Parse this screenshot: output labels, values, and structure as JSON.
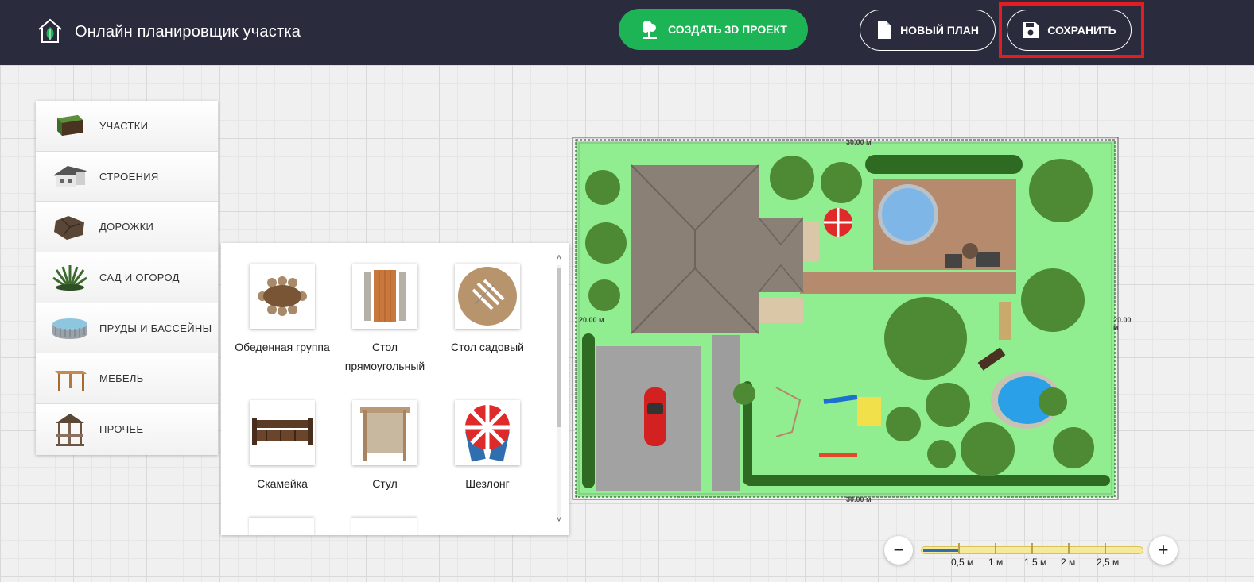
{
  "header": {
    "app_title": "Онлайн планировщик участка",
    "create_3d_label": "СОЗДАТЬ 3D ПРОЕКТ",
    "new_plan_label": "НОВЫЙ ПЛАН",
    "save_label": "СОХРАНИТЬ"
  },
  "categories": [
    {
      "label": "УЧАСТКИ",
      "icon": "grass-tile-icon"
    },
    {
      "label": "СТРОЕНИЯ",
      "icon": "house-icon"
    },
    {
      "label": "ДОРОЖКИ",
      "icon": "paving-tile-icon"
    },
    {
      "label": "САД И ОГОРОД",
      "icon": "bush-icon"
    },
    {
      "label": "ПРУДЫ И БАССЕЙНЫ",
      "icon": "pool-icon"
    },
    {
      "label": "МЕБЕЛЬ",
      "icon": "table-icon"
    },
    {
      "label": "ПРОЧЕЕ",
      "icon": "gazebo-icon"
    }
  ],
  "items": [
    {
      "label": "Обеденная группа",
      "icon": "dining-set-icon"
    },
    {
      "label": "Стол прямоугольный",
      "icon": "rectangular-table-icon"
    },
    {
      "label": "Стол садовый",
      "icon": "garden-table-icon"
    },
    {
      "label": "Скамейка",
      "icon": "bench-icon"
    },
    {
      "label": "Стул",
      "icon": "chair-icon"
    },
    {
      "label": "Шезлонг",
      "icon": "sunbed-icon"
    }
  ],
  "plot": {
    "width_label": "30.00 м",
    "height_label": "20.00 м"
  },
  "zoom": {
    "minus": "−",
    "plus": "+",
    "scale_labels": [
      "0,5 м",
      "1 м",
      "1,5 м",
      "2 м",
      "2,5 м"
    ],
    "fill_fraction": 0.16
  },
  "colors": {
    "header_bg": "#2a2b3d",
    "accent_green": "#1db455",
    "highlight_red": "#e41b23",
    "lawn": "#90ee90"
  }
}
